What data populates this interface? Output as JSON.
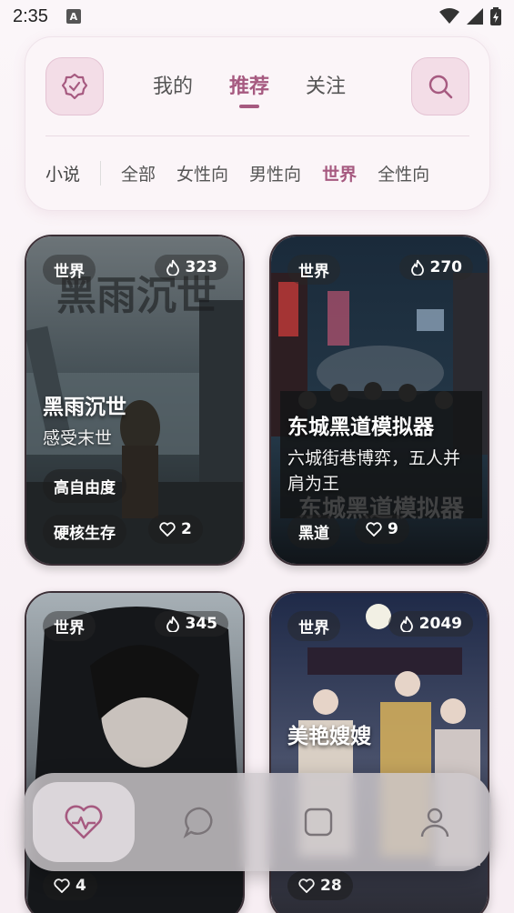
{
  "status": {
    "time": "2:35",
    "notif": "A"
  },
  "header": {
    "tabs": [
      {
        "label": "我的"
      },
      {
        "label": "推荐"
      },
      {
        "label": "关注"
      }
    ],
    "category_label": "小说",
    "categories": [
      "全部",
      "女性向",
      "男性向",
      "世界",
      "全性向"
    ]
  },
  "cards": [
    {
      "tag": "世界",
      "heat": "323",
      "title": "黑雨沉世",
      "subtitle": "感受末世",
      "chips": [
        "高自由度",
        "硬核生存"
      ],
      "likes": "2"
    },
    {
      "tag": "世界",
      "heat": "270",
      "title": "东城黑道模拟器",
      "subtitle": "六城街巷博弈，五人并肩为王",
      "chips": [
        "黑道"
      ],
      "likes": "9"
    },
    {
      "tag": "世界",
      "heat": "345",
      "title": "",
      "subtitle": "",
      "chips": [],
      "likes": "4"
    },
    {
      "tag": "世界",
      "heat": "2049",
      "title": "美艳嫂嫂",
      "subtitle": "",
      "chips": [],
      "likes": "28"
    }
  ],
  "bottom_nav": {
    "items": [
      "heart-pulse-icon",
      "chat-bubble-icon",
      "grid-icon",
      "user-icon"
    ]
  },
  "colors": {
    "accent": "#a65a80",
    "panel": "#fbf5f8"
  }
}
